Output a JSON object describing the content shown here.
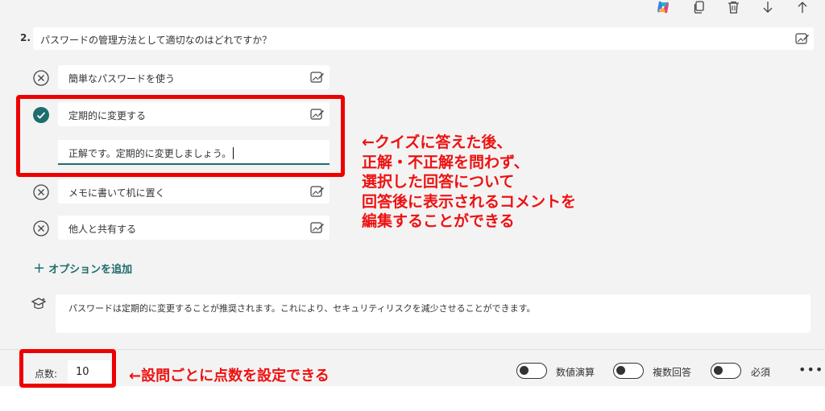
{
  "toolbar": {
    "icons": [
      "copilot-icon",
      "copy-icon",
      "delete-icon",
      "move-down-icon",
      "move-up-icon"
    ]
  },
  "question": {
    "number": "2.",
    "text": "パスワードの管理方法として適切なのはどれですか？"
  },
  "options": [
    {
      "text": "簡単なパスワードを使う",
      "correct": false
    },
    {
      "text": "定期的に変更する",
      "correct": true
    },
    {
      "text": "メモに書いて机に置く",
      "correct": false
    },
    {
      "text": "他人と共有する",
      "correct": false
    }
  ],
  "option_comment": "正解です。定期的に変更しましょう。",
  "add_option_label": "オプションを追加",
  "explanation": "パスワードは定期的に変更することが推奨されます。これにより、セキュリティリスクを減少させることができます。",
  "annotations": {
    "comment_note": [
      "←クイズに答えた後、",
      "正解・不正解を問わず、",
      "選択した回答について",
      "回答後に表示されるコメントを",
      "編集することができる"
    ],
    "points_note": "←設問ごとに点数を設定できる"
  },
  "footer": {
    "points_label": "点数:",
    "points_value": "10",
    "toggles": [
      {
        "label": "数値演算",
        "on": false
      },
      {
        "label": "複数回答",
        "on": false
      },
      {
        "label": "必須",
        "on": false
      }
    ],
    "more_label": "•••"
  },
  "colors": {
    "accent": "#1e6d6d",
    "annotation_red": "#ee1111",
    "background": "#f3f3f3"
  }
}
